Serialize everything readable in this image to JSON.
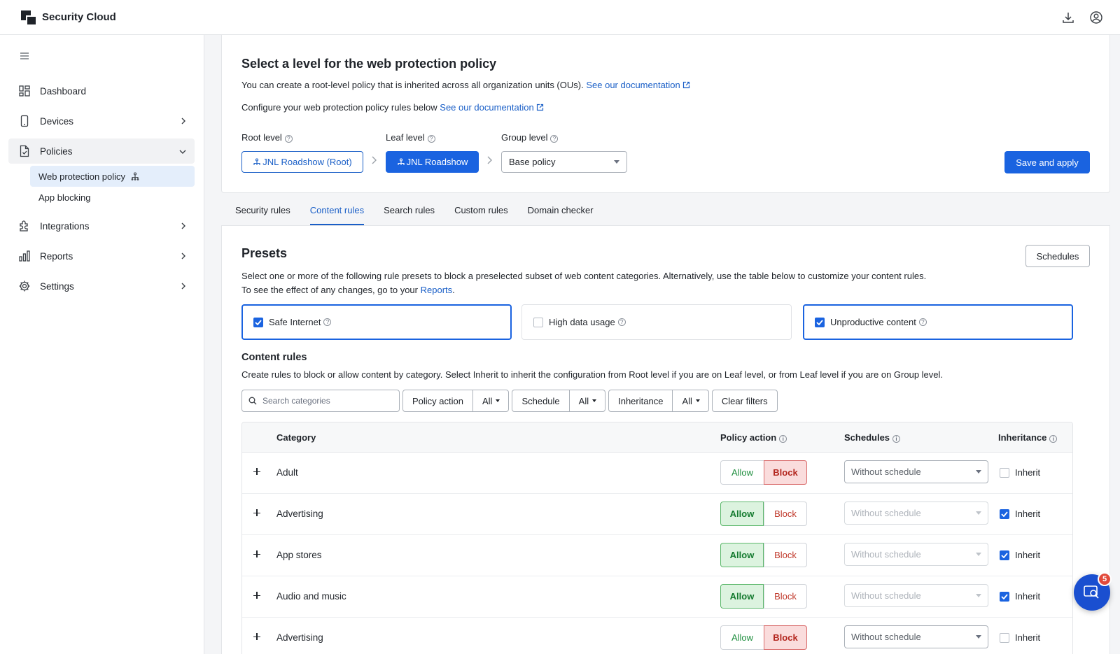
{
  "app": {
    "title": "Security Cloud"
  },
  "sidebar": {
    "items": [
      {
        "label": "Dashboard",
        "icon": "dashboard-icon"
      },
      {
        "label": "Devices",
        "icon": "device-icon"
      },
      {
        "label": "Policies",
        "icon": "policy-icon"
      },
      {
        "label": "Integrations",
        "icon": "puzzle-icon"
      },
      {
        "label": "Reports",
        "icon": "bar-chart-icon"
      },
      {
        "label": "Settings",
        "icon": "gear-icon"
      }
    ],
    "policies_sub": [
      {
        "label": "Web protection policy"
      },
      {
        "label": "App blocking"
      }
    ]
  },
  "level": {
    "title": "Select a level for the web protection policy",
    "desc1": "You can create a root-level policy that is inherited across all organization units (OUs).",
    "desc2": "Configure your web protection policy rules below",
    "doc_link": "See our documentation",
    "root_label": "Root level",
    "leaf_label": "Leaf level",
    "group_label": "Group level",
    "root_value": "JNL Roadshow (Root)",
    "leaf_value": "JNL Roadshow",
    "group_value": "Base policy",
    "save_label": "Save and apply"
  },
  "tabs": [
    {
      "label": "Security rules"
    },
    {
      "label": "Content rules"
    },
    {
      "label": "Search rules"
    },
    {
      "label": "Custom rules"
    },
    {
      "label": "Domain checker"
    }
  ],
  "presets": {
    "title": "Presets",
    "schedules_label": "Schedules",
    "desc1": "Select one or more of the following rule presets to block a preselected subset of web content categories. Alternatively, use the table below to customize your content rules.",
    "desc2": "To see the effect of any changes, go to your",
    "reports_link": "Reports",
    "items": [
      {
        "label": "Safe Internet",
        "checked": true
      },
      {
        "label": "High data usage",
        "checked": false
      },
      {
        "label": "Unproductive content",
        "checked": true
      }
    ]
  },
  "content_rules": {
    "title": "Content rules",
    "desc": "Create rules to block or allow content by category. Select Inherit to inherit the configuration from Root level if you are on Leaf level, or from Leaf level if you are on Group level.",
    "search_placeholder": "Search categories",
    "filters": [
      {
        "label": "Policy action",
        "value": "All"
      },
      {
        "label": "Schedule",
        "value": "All"
      },
      {
        "label": "Inheritance",
        "value": "All"
      }
    ],
    "clear_label": "Clear filters",
    "columns": {
      "category": "Category",
      "policy_action": "Policy action",
      "schedules": "Schedules",
      "inheritance": "Inheritance"
    },
    "allow_label": "Allow",
    "block_label": "Block",
    "inherit_label": "Inherit",
    "rows": [
      {
        "category": "Adult",
        "action": "Block",
        "schedule": "Without schedule",
        "inherit": false
      },
      {
        "category": "Advertising",
        "action": "Allow",
        "schedule": "Without schedule",
        "inherit": true
      },
      {
        "category": "App stores",
        "action": "Allow",
        "schedule": "Without schedule",
        "inherit": true
      },
      {
        "category": "Audio and music",
        "action": "Allow",
        "schedule": "Without schedule",
        "inherit": true
      },
      {
        "category": "Advertising",
        "action": "Block",
        "schedule": "Without schedule",
        "inherit": false
      }
    ]
  },
  "help_fab": {
    "badge": "5",
    "icon": "search-help-icon"
  },
  "colors": {
    "accent": "#1a63e0",
    "allow": "#1e8e3e",
    "block": "#c0392b"
  }
}
